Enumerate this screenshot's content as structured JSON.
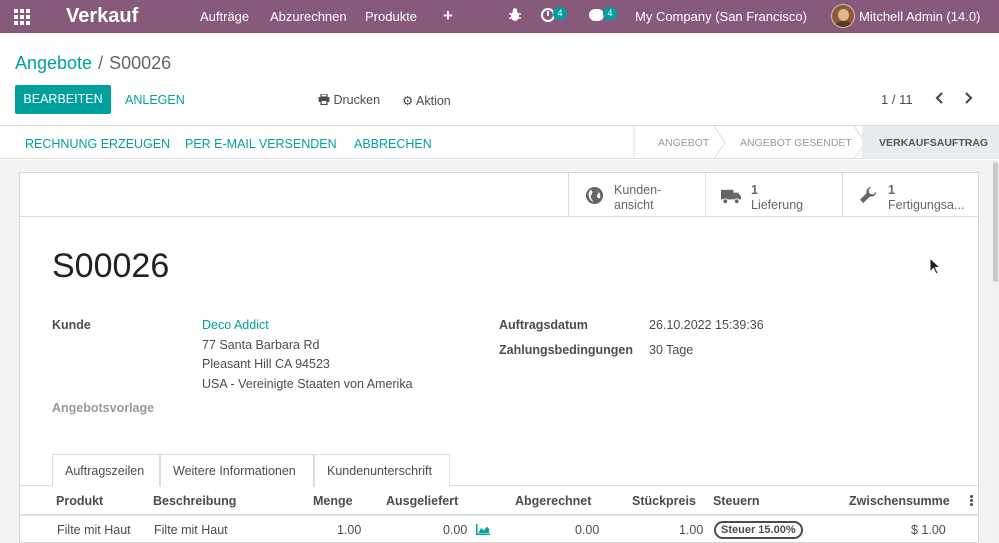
{
  "navbar": {
    "app_title": "Verkauf",
    "menu": [
      "Aufträge",
      "Abzurechnen",
      "Produkte"
    ],
    "activity_count": "4",
    "message_count": "4",
    "company": "My Company (San Francisco)",
    "user": "Mitchell Admin (14.0)",
    "color": "#875a7b"
  },
  "breadcrumb": {
    "parent": "Angebote",
    "separator": "/",
    "current": "S00026"
  },
  "controls": {
    "edit_label": "BEARBEITEN",
    "create_label": "ANLEGEN",
    "print_label": "Drucken",
    "action_label": "Aktion",
    "pager": "1 / 11"
  },
  "status_bar": {
    "buttons": [
      "RECHNUNG ERZEUGEN",
      "PER E-MAIL VERSENDEN",
      "ABBRECHEN"
    ],
    "stages": [
      "ANGEBOT",
      "ANGEBOT GESENDET",
      "VERKAUFSAUFTRAG"
    ],
    "active_stage": "VERKAUFSAUFTRAG"
  },
  "smart_buttons": {
    "customer_preview": {
      "line1": "Kunden-",
      "line2": "ansicht",
      "icon": "globe-icon"
    },
    "delivery": {
      "count": "1",
      "label": "Lieferung",
      "icon": "truck-icon"
    },
    "manufacturing": {
      "count": "1",
      "label": "Fertigungsa...",
      "icon": "wrench-icon"
    }
  },
  "record": {
    "name": "S00026",
    "customer_label": "Kunde",
    "customer_name": "Deco Addict",
    "address_line1": "77 Santa Barbara Rd",
    "address_line2": "Pleasant Hill CA 94523",
    "address_line3": "USA - Vereinigte Staaten von Amerika",
    "template_label": "Angebotsvorlage",
    "order_date_label": "Auftragsdatum",
    "order_date": "26.10.2022 15:39:36",
    "payment_terms_label": "Zahlungsbedingungen",
    "payment_terms": "30 Tage"
  },
  "tabs": [
    "Auftragszeilen",
    "Weitere Informationen",
    "Kundenunterschrift"
  ],
  "order_lines": {
    "columns": [
      "Produkt",
      "Beschreibung",
      "Menge",
      "Ausgeliefert",
      "Abgerechnet",
      "Stückpreis",
      "Steuern",
      "Zwischensumme"
    ],
    "rows": [
      {
        "product": "Filte mit Haut",
        "description": "Filte mit Haut",
        "quantity": "1.00",
        "delivered": "0.00",
        "invoiced": "0.00",
        "unit_price": "1.00",
        "tax": "Steuer 15.00%",
        "subtotal": "$ 1.00"
      }
    ]
  },
  "colors": {
    "primary": "#00a09d",
    "brand": "#875a7b"
  }
}
